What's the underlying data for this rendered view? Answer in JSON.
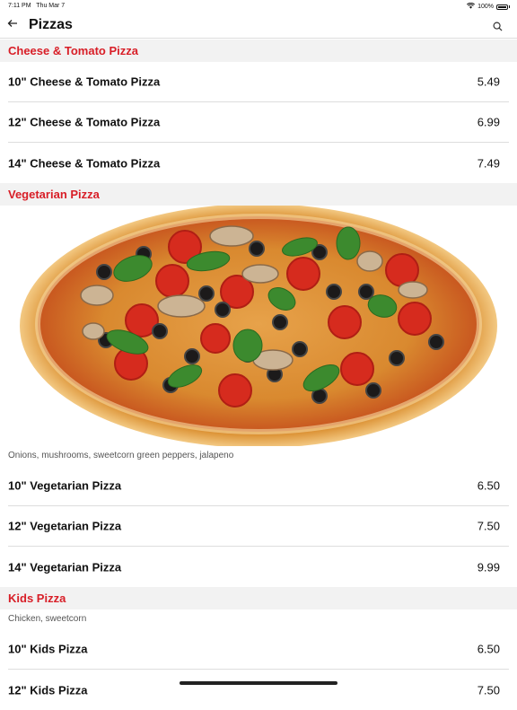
{
  "status_bar": {
    "time": "7:11 PM",
    "date": "Thu Mar 7",
    "battery": "100%"
  },
  "header": {
    "title": "Pizzas",
    "back_icon": "arrow-left-icon",
    "search_icon": "search-icon"
  },
  "sections": [
    {
      "title": "Cheese & Tomato Pizza",
      "items": [
        {
          "name": "10\" Cheese & Tomato Pizza",
          "price": "5.49"
        },
        {
          "name": "12\" Cheese & Tomato Pizza",
          "price": "6.99"
        },
        {
          "name": "14\" Cheese & Tomato Pizza",
          "price": "7.49"
        }
      ]
    },
    {
      "title": "Vegetarian Pizza",
      "description": "Onions, mushrooms, sweetcorn green peppers, jalapeno",
      "items": [
        {
          "name": "10\" Vegetarian Pizza",
          "price": "6.50"
        },
        {
          "name": "12\" Vegetarian Pizza",
          "price": "7.50"
        },
        {
          "name": "14\" Vegetarian Pizza",
          "price": "9.99"
        }
      ]
    },
    {
      "title": "Kids Pizza",
      "description": "Chicken, sweetcorn",
      "items": [
        {
          "name": "10\" Kids Pizza",
          "price": "6.50"
        },
        {
          "name": "12\" Kids Pizza",
          "price": "7.50"
        }
      ]
    }
  ],
  "colors": {
    "accent": "#d81e27",
    "section_bg": "#f2f2f2",
    "divider": "#dddddd"
  }
}
